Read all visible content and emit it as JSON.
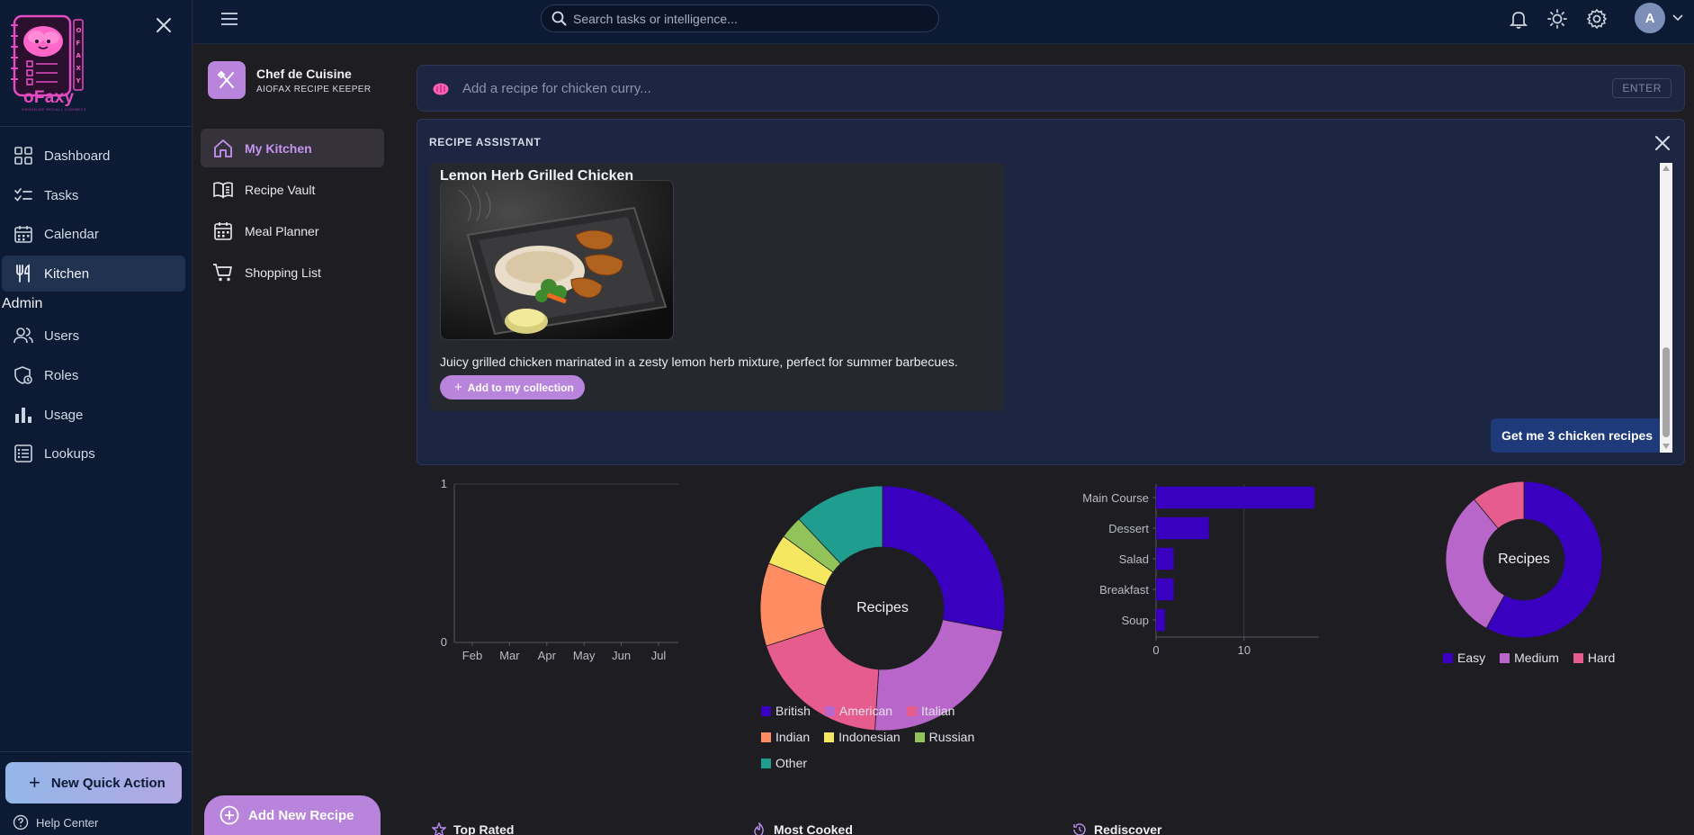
{
  "app": {
    "logo_text": "oFaxy",
    "logo_tagline": "ORGANIZE RECALL CONNECT",
    "logo_letters": [
      "O",
      "F",
      "A",
      "X",
      "Y"
    ]
  },
  "sidebar": {
    "items": [
      {
        "label": "Dashboard",
        "icon": "grid-icon"
      },
      {
        "label": "Tasks",
        "icon": "checklist-icon"
      },
      {
        "label": "Calendar",
        "icon": "calendar-icon"
      },
      {
        "label": "Kitchen",
        "icon": "utensils-icon",
        "active": true
      }
    ],
    "admin_label": "Admin",
    "admin_items": [
      {
        "label": "Users",
        "icon": "users-icon"
      },
      {
        "label": "Roles",
        "icon": "shield-icon"
      },
      {
        "label": "Usage",
        "icon": "bar-chart-icon"
      },
      {
        "label": "Lookups",
        "icon": "list-icon"
      }
    ],
    "quick_action": "New Quick Action",
    "help_center": "Help Center"
  },
  "topbar": {
    "search_placeholder": "Search tasks or intelligence...",
    "avatar_initial": "A"
  },
  "kitchen": {
    "title": "Chef de Cuisine",
    "subtitle": "AIOFAX RECIPE KEEPER",
    "items": [
      {
        "label": "My Kitchen",
        "icon": "home-icon",
        "active": true
      },
      {
        "label": "Recipe Vault",
        "icon": "book-icon"
      },
      {
        "label": "Meal Planner",
        "icon": "calendar-icon"
      },
      {
        "label": "Shopping List",
        "icon": "cart-icon"
      }
    ],
    "add_recipe": "Add New Recipe"
  },
  "recipe_bar": {
    "placeholder": "Add a recipe for chicken curry...",
    "enter_label": "ENTER"
  },
  "assistant": {
    "title": "RECIPE ASSISTANT",
    "recipe_name": "Lemon Herb Grilled Chicken",
    "recipe_desc": "Juicy grilled chicken marinated in a zesty lemon herb mixture, perfect for summer barbecues.",
    "add_collection": "Add to my collection",
    "suggestion_chip": "Get me 3 chicken recipes"
  },
  "sections": {
    "top_rated": "Top Rated",
    "most_cooked": "Most Cooked",
    "rediscover": "Rediscover"
  },
  "colors": {
    "accent_purple": "#b984dc",
    "nav_bg": "#0c1a33",
    "chart_indigo": "#3a00c0"
  },
  "chart_data": [
    {
      "type": "line",
      "categories": [
        "Feb",
        "Mar",
        "Apr",
        "May",
        "Jun",
        "Jul"
      ],
      "yticks": [
        "0",
        "1"
      ],
      "ylim": [
        0,
        1
      ],
      "series": []
    },
    {
      "type": "pie",
      "variant": "donut",
      "center_label": "Recipes",
      "slices": [
        {
          "label": "British",
          "value": 28,
          "color": "#3a00c0"
        },
        {
          "label": "American",
          "value": 23,
          "color": "#b866c9"
        },
        {
          "label": "Italian",
          "value": 19,
          "color": "#e65c8d"
        },
        {
          "label": "Indian",
          "value": 11,
          "color": "#ff8c63"
        },
        {
          "label": "Indonesian",
          "value": 4,
          "color": "#f6e760"
        },
        {
          "label": "Russian",
          "value": 3,
          "color": "#92c25a"
        },
        {
          "label": "Other",
          "value": 12,
          "color": "#1f9e8f"
        }
      ],
      "legend": "bottom"
    },
    {
      "type": "bar",
      "orientation": "horizontal",
      "categories": [
        "Main Course",
        "Dessert",
        "Salad",
        "Breakfast",
        "Soup"
      ],
      "values": [
        18,
        6,
        2,
        2,
        1
      ],
      "xticks": [
        "0",
        "10"
      ],
      "xlim": [
        0,
        18.5
      ],
      "color": "#3a00c0"
    },
    {
      "type": "pie",
      "variant": "donut",
      "center_label": "Recipes",
      "slices": [
        {
          "label": "Easy",
          "value": 58,
          "color": "#3a00c0"
        },
        {
          "label": "Medium",
          "value": 31,
          "color": "#b866c9"
        },
        {
          "label": "Hard",
          "value": 11,
          "color": "#e65c8d"
        }
      ],
      "legend": "bottom"
    }
  ]
}
